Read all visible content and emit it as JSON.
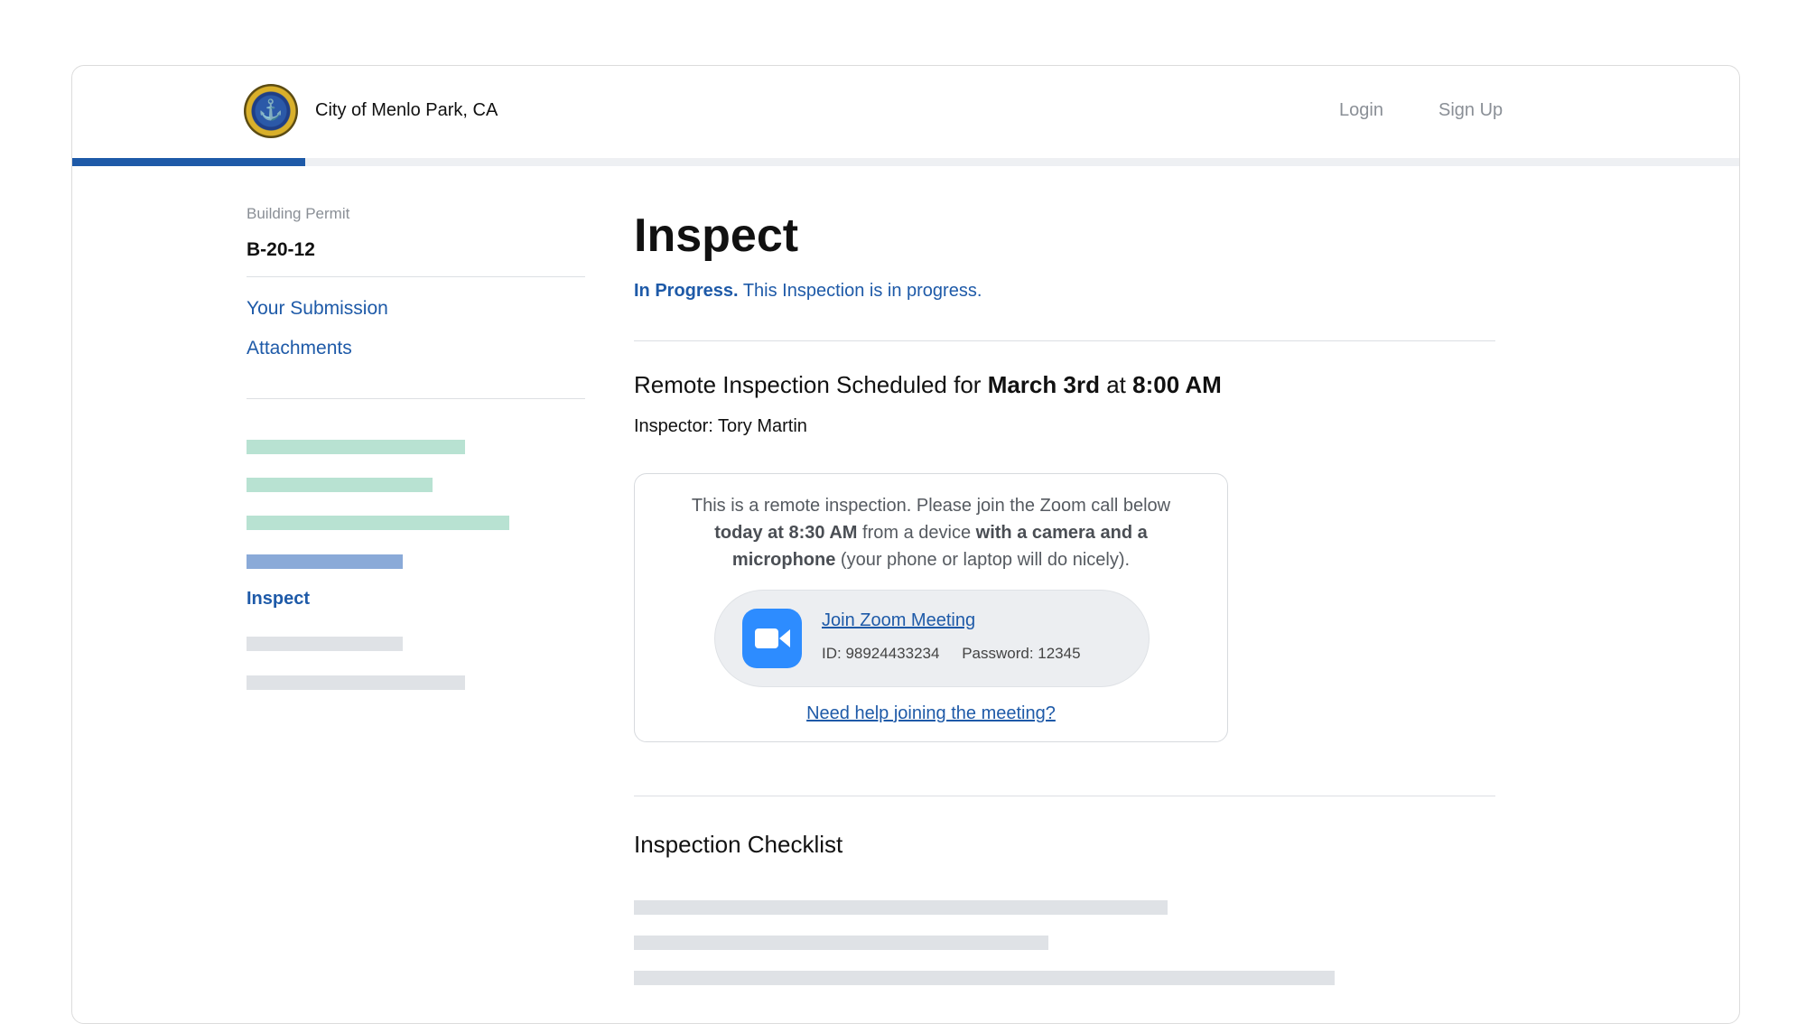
{
  "header": {
    "city_name": "City of Menlo Park, CA",
    "login_label": "Login",
    "signup_label": "Sign Up",
    "progress_fraction": 0.14,
    "colors": {
      "accent": "#1e5aa8",
      "track": "#eef0f3"
    }
  },
  "sidebar": {
    "permit_label": "Building Permit",
    "permit_id": "B-20-12",
    "links": [
      "Your Submission",
      "Attachments"
    ],
    "active_step": "Inspect",
    "step_colors": {
      "complete": "#b8e2d2",
      "current": "#8aaad8",
      "pending": "#dfe2e6"
    }
  },
  "main": {
    "title": "Inspect",
    "status_strong": "In Progress.",
    "status_text": "This Inspection is in progress.",
    "schedule": {
      "prefix": "Remote Inspection Scheduled for",
      "date": "March 3rd",
      "connector": "at",
      "time": "8:00 AM"
    },
    "inspector": "Inspector: Tory Martin",
    "zoom": {
      "text_1": "This is a remote inspection. Please join the Zoom call below",
      "text_bold_1": "today at 8:30 AM",
      "text_2": "from a device",
      "text_bold_2": "with a camera and a microphone",
      "text_3": "(your phone or laptop will do nicely).",
      "join_label": "Join Zoom Meeting",
      "meeting_id": "ID: 98924433234",
      "password": "Password: 12345",
      "help_link": "Need help joining the meeting?",
      "icon": "zoom-camera-icon",
      "icon_color": "#2d8cff"
    },
    "checklist_title": "Inspection Checklist"
  }
}
